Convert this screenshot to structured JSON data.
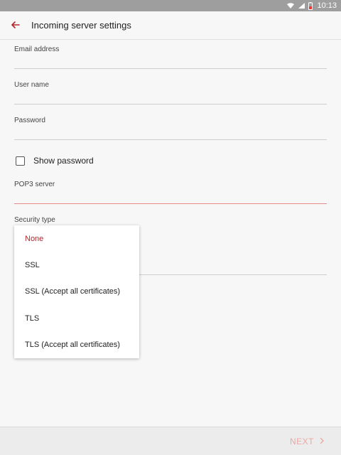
{
  "status_bar": {
    "time": "10:13"
  },
  "app_bar": {
    "title": "Incoming server settings"
  },
  "fields": {
    "email": {
      "label": "Email address",
      "value": ""
    },
    "username": {
      "label": "User name",
      "value": ""
    },
    "password": {
      "label": "Password",
      "value": ""
    },
    "show_password": {
      "label": "Show password",
      "checked": false
    },
    "pop3": {
      "label": "POP3 server",
      "value": ""
    },
    "security": {
      "label": "Security type"
    }
  },
  "security_dropdown": {
    "selected": "None",
    "options": [
      "None",
      "SSL",
      "SSL (Accept all certificates)",
      "TLS",
      "TLS (Accept all certificates)"
    ]
  },
  "bottom_bar": {
    "next_label": "NEXT"
  },
  "colors": {
    "accent": "#b0282e",
    "active_underline": "#e38b84",
    "next_disabled": "#eaa8a4"
  }
}
